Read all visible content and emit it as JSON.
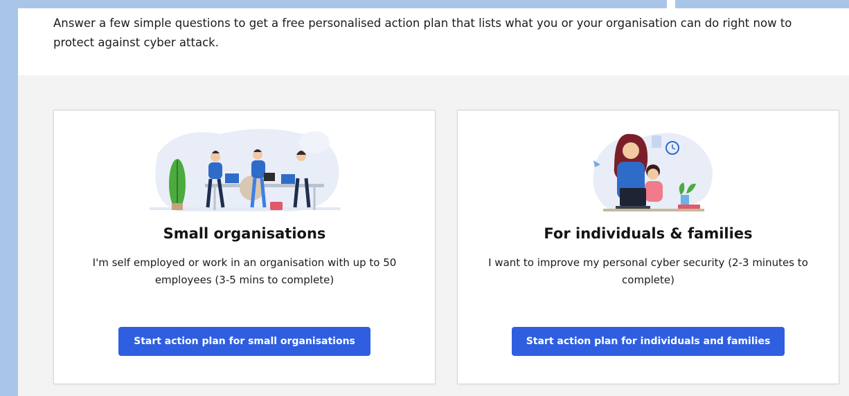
{
  "intro": {
    "text": "Answer a few simple questions to get a free personalised action plan that lists what you or your organisation can do right now to protect against cyber attack."
  },
  "cards": [
    {
      "title": "Small organisations",
      "description": "I'm self employed or work in an organisation with up to 50 employees (3-5 mins to complete)",
      "button_label": "Start action plan for small organisations",
      "illustration": "team-at-desk-illustration"
    },
    {
      "title": "For individuals & families",
      "description": "I want to improve my personal cyber security (2-3 minutes to complete)",
      "button_label": "Start action plan for individuals and families",
      "illustration": "parent-child-laptop-illustration"
    }
  ],
  "colors": {
    "accent": "#2f5fe0",
    "frame": "#a9c6e8",
    "panel": "#f3f3f4"
  }
}
